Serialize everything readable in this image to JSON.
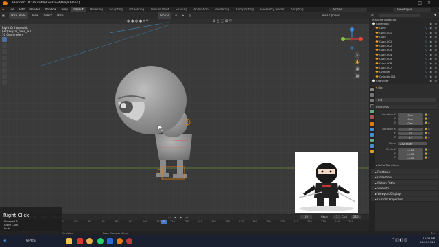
{
  "window": {
    "title": "Blender* [D:\\Youtube\\Course-R\\Ninja.blend]"
  },
  "menu": {
    "items": [
      "File",
      "Edit",
      "Render",
      "Window",
      "Help"
    ],
    "workspaces": [
      "Layout",
      "Modeling",
      "Sculpting",
      "UV Editing",
      "Texture Paint",
      "Shading",
      "Animation",
      "Rendering",
      "Compositing",
      "Geometry Nodes",
      "Scripting"
    ],
    "active_workspace": "Layout",
    "scene": "Scene",
    "view_layer": "ViewLayer"
  },
  "viewport": {
    "mode": "Pose Mode",
    "menus": [
      "View",
      "Select",
      "Pose"
    ],
    "orientation": "Global",
    "pose_options": "Pose Options",
    "info_lines": [
      "Right Orthographic",
      "(32) Rig: r.l_hand_ik.l",
      "10 Centimeters"
    ]
  },
  "outliner": {
    "title": "Scene Collection",
    "items": [
      {
        "name": "Collection",
        "indent": 1
      },
      {
        "name": "Cone",
        "indent": 2
      },
      {
        "name": "Cone.001",
        "indent": 2
      },
      {
        "name": "Cube",
        "indent": 2
      },
      {
        "name": "Cube.001",
        "indent": 2
      },
      {
        "name": "Cube.002",
        "indent": 2
      },
      {
        "name": "Cube.003",
        "indent": 2
      },
      {
        "name": "Cube.004",
        "indent": 2
      },
      {
        "name": "Cube.005",
        "indent": 2
      },
      {
        "name": "Cube.006",
        "indent": 2
      },
      {
        "name": "Cube.007",
        "indent": 2
      },
      {
        "name": "Cylinder",
        "indent": 2
      },
      {
        "name": "Cylinder.001",
        "indent": 2
      },
      {
        "name": "Character",
        "indent": 1
      }
    ]
  },
  "properties": {
    "object_name": "Rig",
    "data_name": "Rig",
    "transform_label": "Transform",
    "location": {
      "label": "Location X",
      "x": "0 m",
      "y": "0 m",
      "z": "0 m"
    },
    "rotation": {
      "label": "Rotation X",
      "x": "0°",
      "y": "0°",
      "z": "0°"
    },
    "mode_label": "Mode",
    "mode_value": "XYZ Euler",
    "scale": {
      "label": "Scale X",
      "x": "1.000",
      "y": "1.000",
      "z": "1.000"
    },
    "delta_transform": "Delta Transform",
    "sections": [
      "Relations",
      "Collections",
      "Motion Paths",
      "Visibility",
      "Viewport Display",
      "Custom Properties"
    ]
  },
  "timeline": {
    "playback": "Playback",
    "keying": "Keying",
    "view": "View",
    "marker": "Marker",
    "current_frame": "32",
    "start_label": "Start",
    "start": "1",
    "end_label": "End",
    "end": "250",
    "ticks": [
      "40",
      "50",
      "60",
      "70",
      "80",
      "90",
      "100",
      "110",
      "120",
      "130",
      "140",
      "150",
      "160",
      "170",
      "180",
      "190",
      "200",
      "210",
      "220",
      "230",
      "240",
      "250"
    ]
  },
  "status": {
    "items": [
      "Pan View",
      "Pose Context Menu"
    ],
    "version": "3.x"
  },
  "overlay": {
    "title": "Right Click",
    "lines": [
      "Numpad 3",
      "Right Click",
      "Lmb"
    ]
  },
  "taskbar": {
    "item": "GIPhtos",
    "time": "10:09 PM",
    "date": "16-09-2024"
  },
  "colors": {
    "accent": "#e87d0d",
    "selection": "#4db3e6",
    "x_axis": "#e8453c",
    "y_axis": "#84c13a",
    "z_axis": "#3a8be8"
  }
}
